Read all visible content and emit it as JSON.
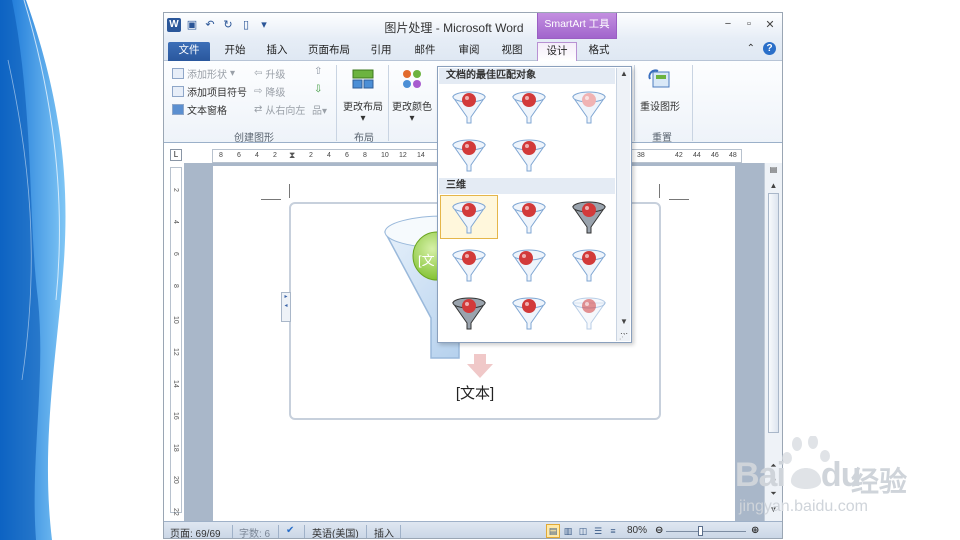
{
  "window": {
    "title": "图片处理 - Microsoft Word",
    "context_tools": "SmartArt 工具",
    "app_icon": "W"
  },
  "tabs": [
    {
      "label": "文件"
    },
    {
      "label": "开始"
    },
    {
      "label": "插入"
    },
    {
      "label": "页面布局"
    },
    {
      "label": "引用"
    },
    {
      "label": "邮件"
    },
    {
      "label": "审阅"
    },
    {
      "label": "视图"
    },
    {
      "label": "设计"
    },
    {
      "label": "格式"
    }
  ],
  "ribbon": {
    "create_graphic": {
      "add_shape": "添加形状",
      "add_bullet": "添加项目符号",
      "text_pane": "文本窗格",
      "promote": "升级",
      "demote": "降级",
      "right_to_left": "从右向左",
      "label": "创建图形"
    },
    "layouts": {
      "change_layout": "更改布局",
      "label": "布局"
    },
    "colors": {
      "change_colors": "更改颜色"
    },
    "reset": {
      "reset_graphic": "重设图形",
      "label": "重置"
    }
  },
  "gallery": {
    "section_best": "文档的最佳匹配对象",
    "section_3d": "三维"
  },
  "ruler": {
    "h_ticks": [
      "8",
      "6",
      "4",
      "2",
      "2",
      "4",
      "6",
      "8",
      "10",
      "12",
      "14",
      "38",
      "42",
      "44",
      "46",
      "48"
    ],
    "v_ticks": [
      "2",
      "4",
      "6",
      "8",
      "10",
      "12",
      "14",
      "16",
      "18",
      "20",
      "22"
    ]
  },
  "document": {
    "smartart_text_left": "[文",
    "smartart_text": "[文本]"
  },
  "statusbar": {
    "page": "页面: 69/69",
    "words": "字数: 6",
    "language": "英语(美国)",
    "mode": "插入",
    "zoom": "80%",
    "zoom_level": 0.42
  },
  "watermark": {
    "brand": "Bai",
    "brand2": "du",
    "brand_cn": "经验",
    "url": "jingyan.baidu.com"
  },
  "colors": {
    "accent_blue": "#2b579a",
    "context_purple": "#a165cc",
    "cone_red": "#d23a3a",
    "selection_gold": "#e5b64a",
    "slide_wave": "#2f8fe0"
  }
}
